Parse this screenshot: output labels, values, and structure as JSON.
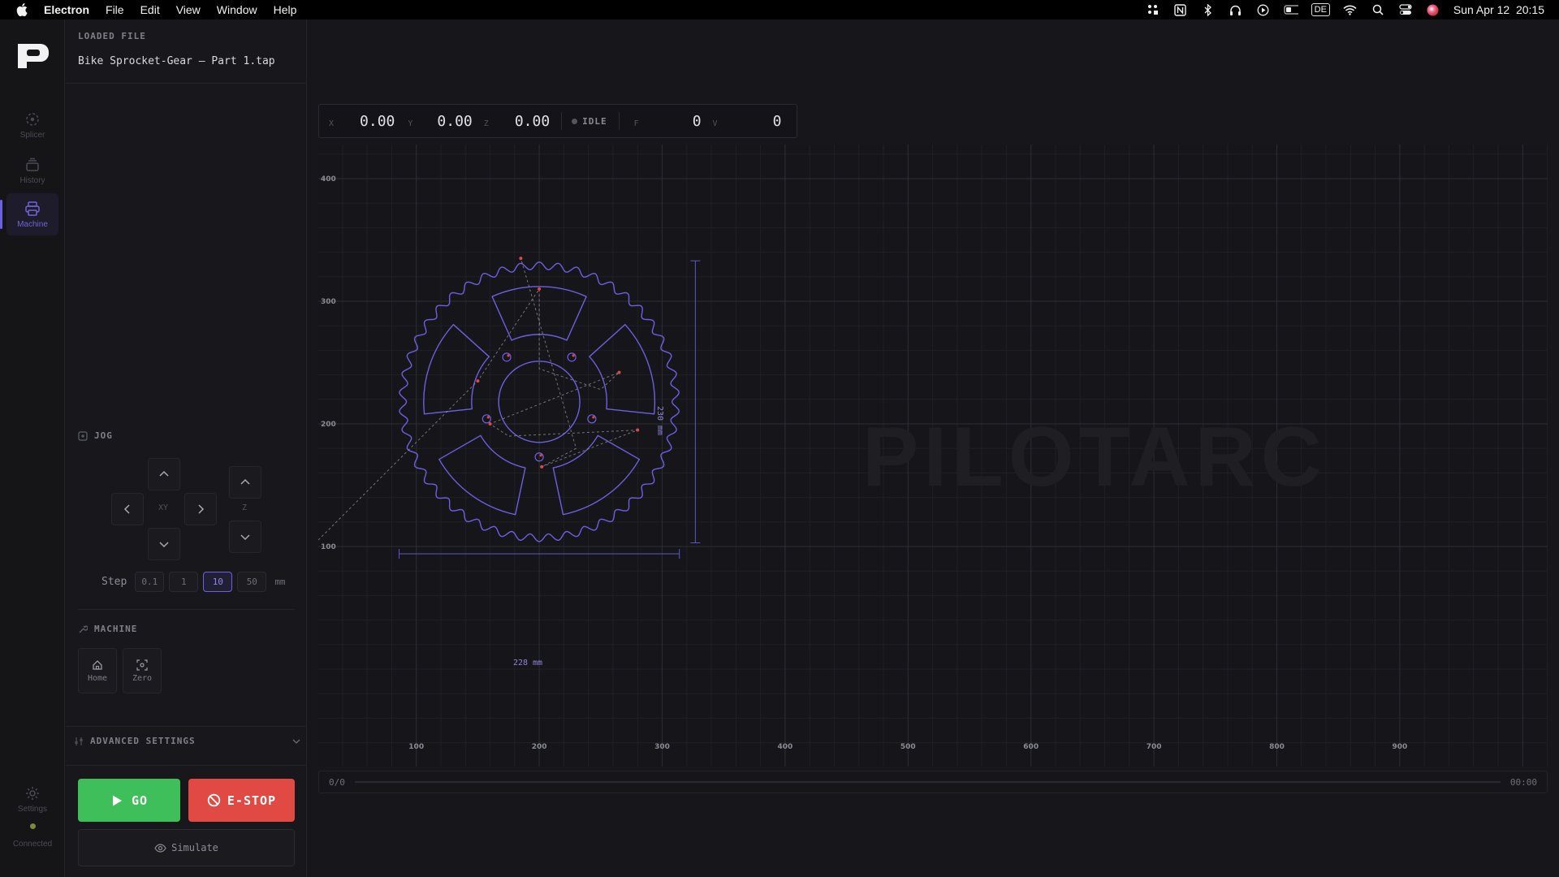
{
  "menubar": {
    "app_name": "Electron",
    "menus": [
      "File",
      "Edit",
      "View",
      "Window",
      "Help"
    ],
    "input_source": "DE",
    "datetime": "Sun Apr 12  20:15"
  },
  "rail": {
    "items": [
      {
        "label": "Splicer",
        "icon": "splicer-icon"
      },
      {
        "label": "History",
        "icon": "history-icon"
      },
      {
        "label": "Machine",
        "icon": "printer-icon"
      }
    ],
    "settings_label": "Settings",
    "status_label": "Connected",
    "accent": "#6d5fe3"
  },
  "panel": {
    "loaded_label": "LOADED FILE",
    "file_name": "Bike Sprocket-Gear – Part 1.tap",
    "jog": {
      "title": "JOG",
      "xy_label": "XY",
      "z_label": "Z",
      "step_label": "Step",
      "steps": [
        "0.1",
        "1",
        "10",
        "50"
      ],
      "selected_step": "10",
      "unit": "mm"
    },
    "machine": {
      "title": "MACHINE",
      "home_label": "Home",
      "zero_label": "Zero"
    },
    "advanced_label": "ADVANCED SETTINGS",
    "go_label": "GO",
    "estop_label": "E-STOP",
    "simulate_label": "Simulate",
    "go_color": "#3fbf5a",
    "estop_color": "#e14a43"
  },
  "dro": {
    "x_label": "X",
    "x": "0.00",
    "y_label": "Y",
    "y": "0.00",
    "z_label": "Z",
    "z": "0.00",
    "state": "IDLE",
    "f_label": "F",
    "f": "0",
    "v_label": "V",
    "v": "0"
  },
  "canvas": {
    "x_ticks": [
      "100",
      "200",
      "300",
      "400",
      "500",
      "600",
      "700",
      "800",
      "900"
    ],
    "y_ticks": [
      "100",
      "200",
      "300",
      "400"
    ],
    "width_dim": "228 mm",
    "height_dim": "230 mm",
    "watermark": "PILOTARC",
    "part_color": "#6c5fe0"
  },
  "progress": {
    "count": "0/0",
    "fraction": 0,
    "time": "00:00"
  }
}
